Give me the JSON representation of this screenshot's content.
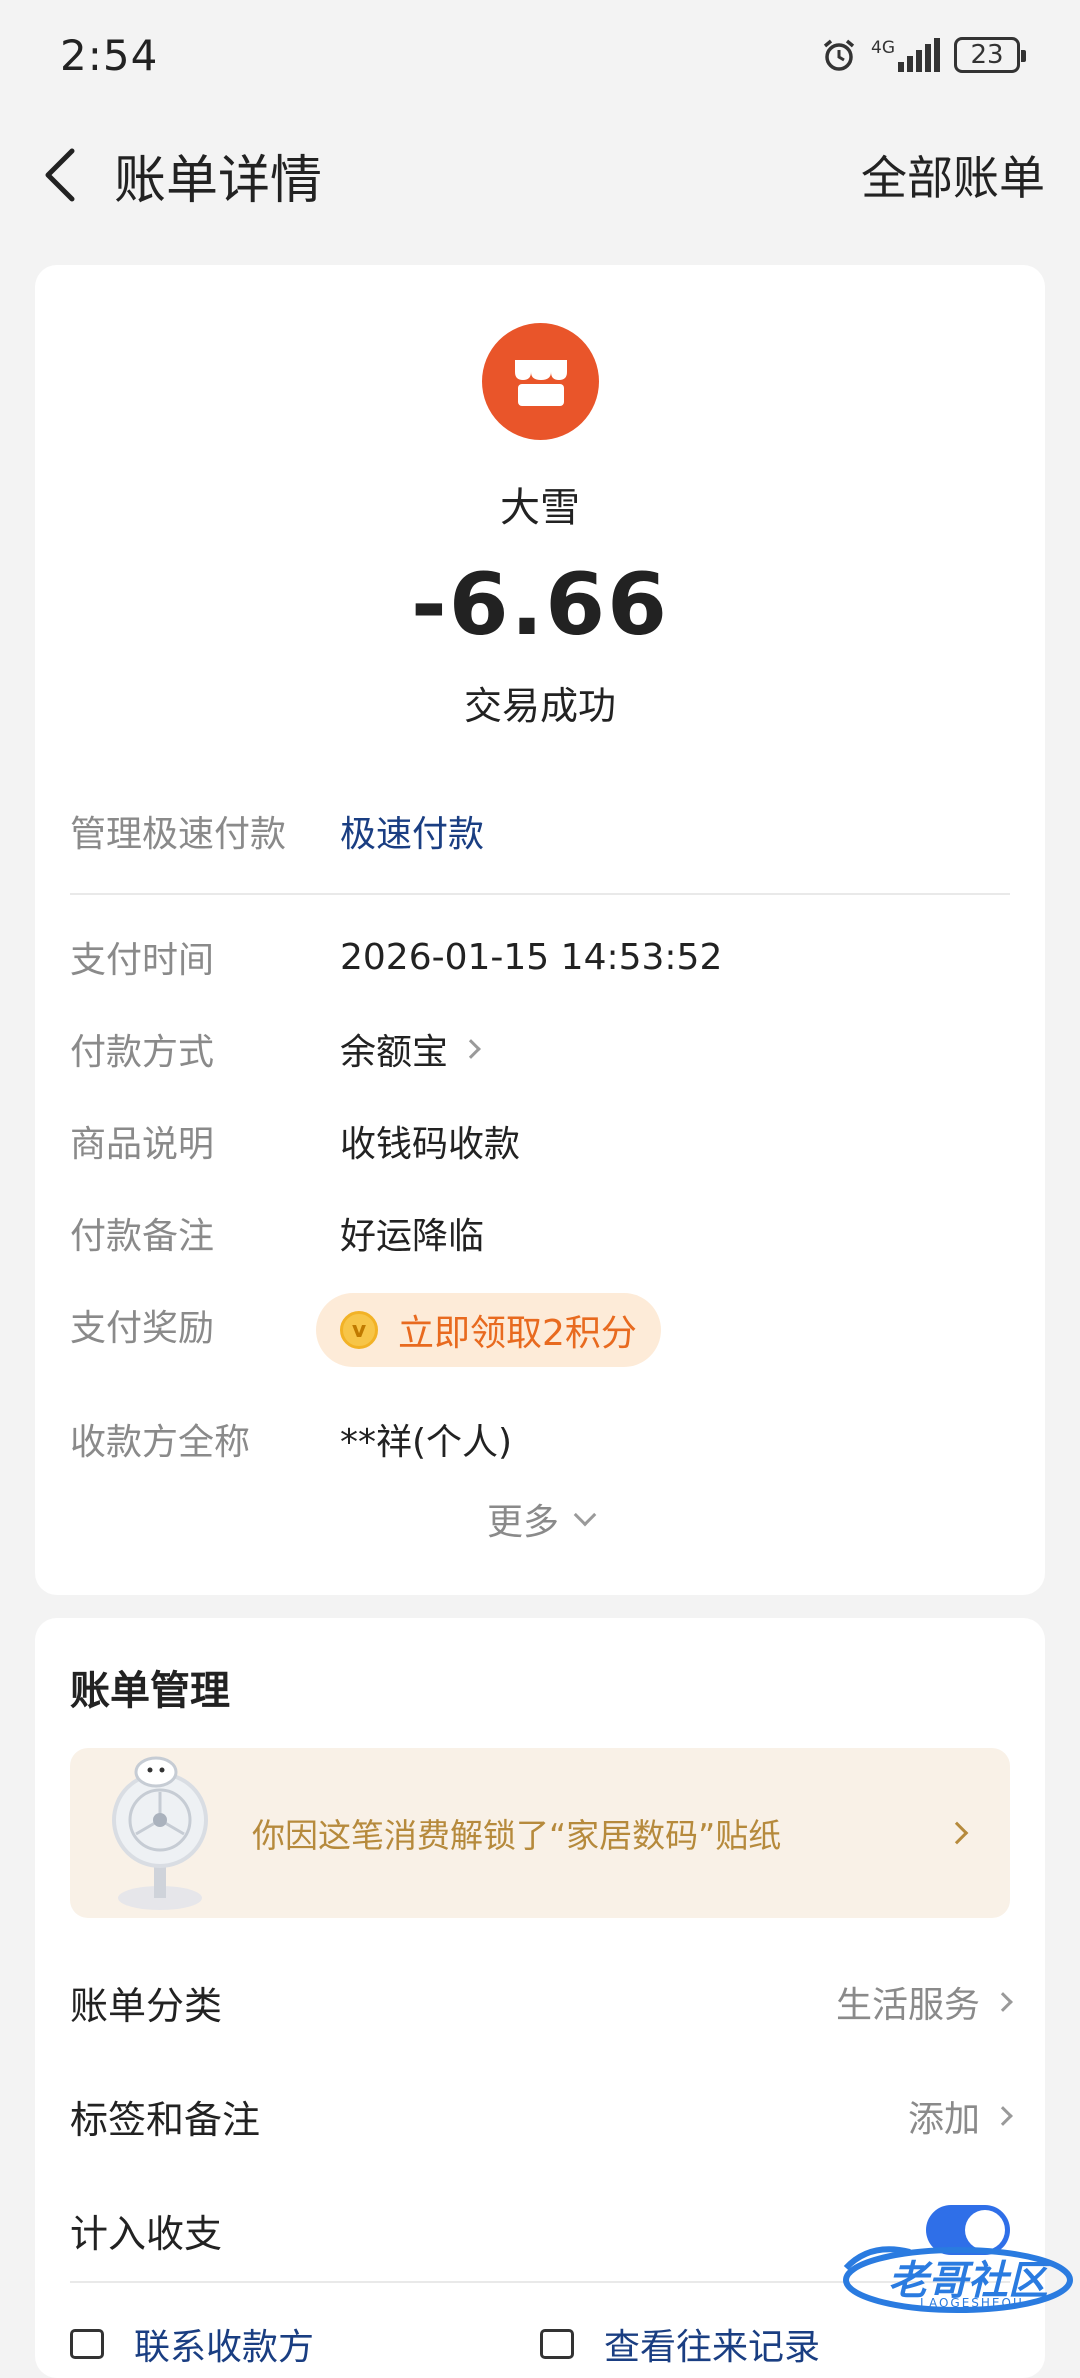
{
  "status_bar": {
    "time": "2:54",
    "network": "4G",
    "battery": "23"
  },
  "nav": {
    "title": "账单详情",
    "right_action": "全部账单"
  },
  "transaction": {
    "merchant": "大雪",
    "amount": "-6.66",
    "status": "交易成功",
    "fast_pay": {
      "label": "管理极速付款",
      "value": "极速付款"
    },
    "details": [
      {
        "label": "支付时间",
        "value": "2026-01-15 14:53:52"
      },
      {
        "label": "付款方式",
        "value": "余额宝"
      },
      {
        "label": "商品说明",
        "value": "收钱码收款"
      },
      {
        "label": "付款备注",
        "value": "好运降临"
      }
    ],
    "reward": {
      "label": "支付奖励",
      "text": "立即领取2积分"
    },
    "payee": {
      "label": "收款方全称",
      "value": "**祥(个人)"
    },
    "more_label": "更多"
  },
  "manage": {
    "title": "账单管理",
    "sticker_banner": "你因这笔消费解锁了“家居数码”贴纸",
    "category": {
      "label": "账单分类",
      "value": "生活服务"
    },
    "tags": {
      "label": "标签和备注",
      "value": "添加"
    },
    "include": {
      "label": "计入收支",
      "enabled": true
    },
    "bottom_links": [
      "联系收款方",
      "查看往来记录"
    ]
  },
  "watermark": {
    "text": "老哥社区",
    "subtext": "LAOGESHEQU"
  },
  "colors": {
    "accent": "#2f6fe8",
    "merchant_icon": "#e9552a",
    "reward": "#e86a1f",
    "link": "#1a3e82"
  }
}
